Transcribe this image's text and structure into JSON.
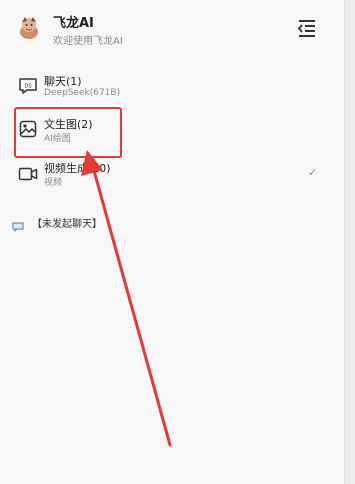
{
  "header": {
    "title": "飞龙AI",
    "subtitle": "欢迎使用飞龙AI"
  },
  "nav": {
    "items": [
      {
        "id": "chat",
        "label": "聊天(1)",
        "sub": "DeepSeek(671B)",
        "icon": "chat-bubble-icon"
      },
      {
        "id": "image",
        "label": "文生图(2)",
        "sub": "AI绘图",
        "icon": "image-icon"
      },
      {
        "id": "video",
        "label": "视频生成(10)",
        "sub": "视频",
        "icon": "video-camera-icon",
        "checked": true
      }
    ]
  },
  "history": {
    "label": "【未发起聊天】"
  },
  "colors": {
    "highlight": "#e53935",
    "background": "#f7f7f7"
  }
}
